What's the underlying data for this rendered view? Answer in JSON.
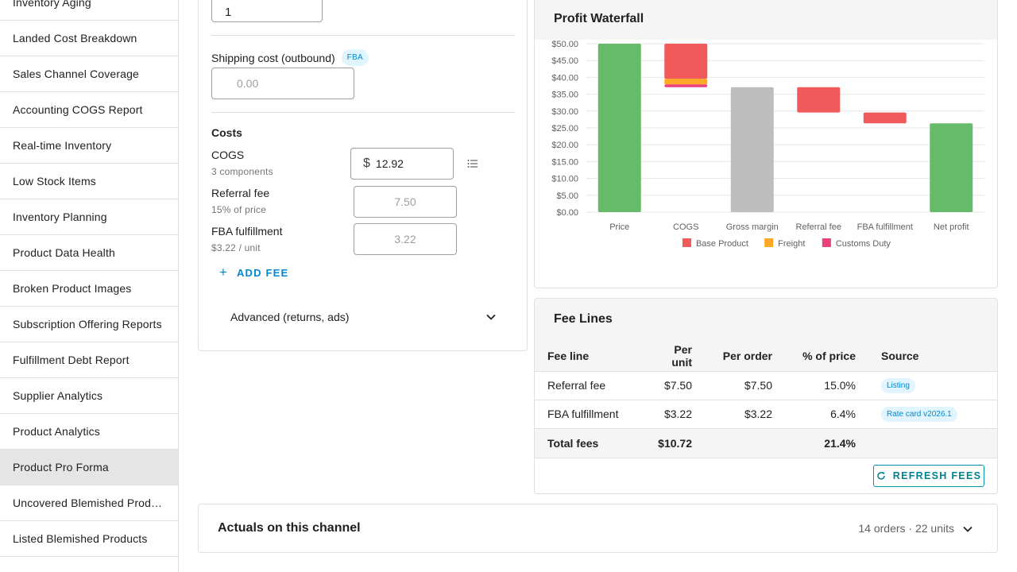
{
  "sidebar": {
    "items": [
      {
        "label": "Inventory Aging",
        "active": false
      },
      {
        "label": "Landed Cost Breakdown",
        "active": false
      },
      {
        "label": "Sales Channel Coverage",
        "active": false
      },
      {
        "label": "Accounting COGS Report",
        "active": false
      },
      {
        "label": "Real-time Inventory",
        "active": false
      },
      {
        "label": "Low Stock Items",
        "active": false
      },
      {
        "label": "Inventory Planning",
        "active": false
      },
      {
        "label": "Product Data Health",
        "active": false
      },
      {
        "label": "Broken Product Images",
        "active": false
      },
      {
        "label": "Subscription Offering Reports",
        "active": false
      },
      {
        "label": "Fulfillment Debt Report",
        "active": false
      },
      {
        "label": "Supplier Analytics",
        "active": false
      },
      {
        "label": "Product Analytics",
        "active": false
      },
      {
        "label": "Product Pro Forma",
        "active": true
      },
      {
        "label": "Uncovered Blemished Products",
        "active": false
      },
      {
        "label": "Listed Blemished Products",
        "active": false
      }
    ]
  },
  "form": {
    "quantity_value": "1",
    "shipping": {
      "label": "Shipping cost (outbound)",
      "badge": "FBA",
      "placeholder": "0.00"
    },
    "costs_title": "Costs",
    "cogs": {
      "label": "COGS",
      "sub": "3 components",
      "currency": "$",
      "value": "12.92"
    },
    "referral": {
      "label": "Referral fee",
      "sub": "15% of price",
      "value": "7.50"
    },
    "fba": {
      "label": "FBA fulfillment",
      "sub": "$3.22 / unit",
      "value": "3.22"
    },
    "add_fee_label": "ADD FEE",
    "advanced_label": "Advanced (returns, ads)"
  },
  "waterfall": {
    "title": "Profit Waterfall"
  },
  "chart_data": {
    "type": "bar",
    "title": "Profit Waterfall",
    "variant": "waterfall",
    "categories": [
      "Price",
      "COGS",
      "Gross margin",
      "Referral fee",
      "FBA fulfillment",
      "Net profit"
    ],
    "ylim": [
      0,
      50
    ],
    "yticks": [
      0,
      5,
      10,
      15,
      20,
      25,
      30,
      35,
      40,
      45,
      50
    ],
    "ytick_format": "$0.00",
    "grid": true,
    "legend_position": "bottom",
    "legend": [
      {
        "name": "Base Product",
        "color": "#f05a5a"
      },
      {
        "name": "Freight",
        "color": "#ffa726"
      },
      {
        "name": "Customs Duty",
        "color": "#ec407a"
      }
    ],
    "bars": [
      {
        "category": "Price",
        "start": 0,
        "end": 50.0,
        "color": "#66bb6a"
      },
      {
        "category": "COGS",
        "segments": [
          {
            "name": "Base Product",
            "start": 50.0,
            "end": 39.6,
            "color": "#f05a5a"
          },
          {
            "name": "Freight",
            "start": 39.6,
            "end": 37.9,
            "color": "#ffa726"
          },
          {
            "name": "Customs Duty",
            "start": 37.9,
            "end": 37.08,
            "color": "#ec407a"
          }
        ]
      },
      {
        "category": "Gross margin",
        "start": 0,
        "end": 37.08,
        "color": "#bdbdbd"
      },
      {
        "category": "Referral fee",
        "start": 37.08,
        "end": 29.58,
        "color": "#f05a5a"
      },
      {
        "category": "FBA fulfillment",
        "start": 29.58,
        "end": 26.36,
        "color": "#f05a5a"
      },
      {
        "category": "Net profit",
        "start": 0,
        "end": 26.36,
        "color": "#66bb6a"
      }
    ]
  },
  "fee_lines": {
    "title": "Fee Lines",
    "columns": [
      "Fee line",
      "Per unit",
      "Per order",
      "% of price",
      "Source"
    ],
    "rows": [
      {
        "name": "Referral fee",
        "per_unit": "$7.50",
        "per_order": "$7.50",
        "pct": "15.0%",
        "source": "Listing"
      },
      {
        "name": "FBA fulfillment",
        "per_unit": "$3.22",
        "per_order": "$3.22",
        "pct": "6.4%",
        "source": "Rate card v2026.1"
      }
    ],
    "total": {
      "label": "Total fees",
      "per_unit": "$10.72",
      "pct": "21.4%"
    },
    "refresh_label": "REFRESH FEES"
  },
  "actuals": {
    "title": "Actuals on this channel",
    "summary": "14 orders · 22 units"
  },
  "colors": {
    "accent": "#0288d1",
    "teal": "#00838f",
    "positive": "#66bb6a",
    "negative": "#f05a5a",
    "neutral": "#bdbdbd"
  }
}
